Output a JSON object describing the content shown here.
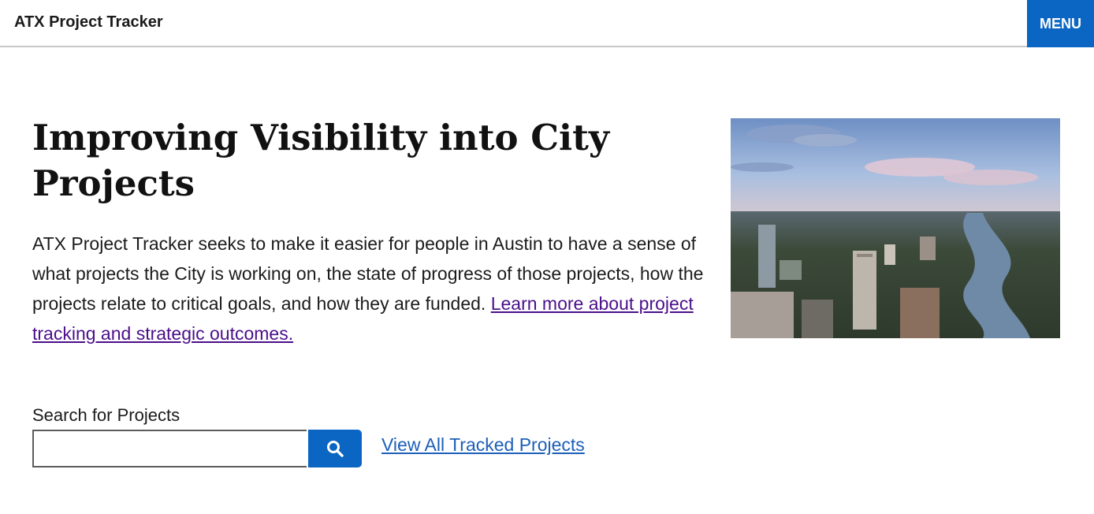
{
  "header": {
    "site_title": "ATX Project Tracker",
    "menu_label": "MENU"
  },
  "hero": {
    "title": "Improving Visibility into City Projects",
    "description": "ATX Project Tracker seeks to make it easier for people in Austin to have a sense of what projects the City is working on, the state of progress of those projects, how the projects relate to critical goals, and how they are funded. ",
    "learn_more_link": "Learn more about project tracking and strategic outcomes."
  },
  "search": {
    "label": "Search for Projects",
    "value": "",
    "placeholder": "",
    "button_icon": "search-icon"
  },
  "links": {
    "view_all": "View All Tracked Projects"
  },
  "colors": {
    "accent": "#0a66c2",
    "link": "#1c5fb8",
    "visited_link": "#4b0f8a"
  }
}
